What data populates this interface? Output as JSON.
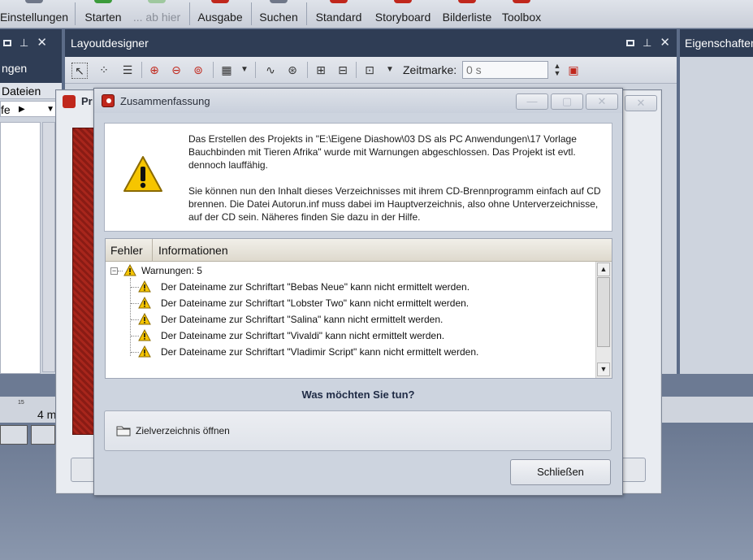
{
  "toolbar": {
    "items": [
      {
        "label": "Einstellungen",
        "enabled": true
      },
      {
        "label": "Starten",
        "enabled": true
      },
      {
        "label": "... ab hier",
        "enabled": false
      },
      {
        "label": "Ausgabe",
        "enabled": true
      },
      {
        "label": "Suchen",
        "enabled": true
      },
      {
        "label": "Standard",
        "enabled": true
      },
      {
        "label": "Storyboard",
        "enabled": true
      },
      {
        "label": "Bilderliste",
        "enabled": true
      },
      {
        "label": "Toolbox",
        "enabled": true
      }
    ]
  },
  "left_panel": {
    "title": "",
    "items": [
      "ngen",
      "Dateien",
      "fe"
    ],
    "ruler_tick": "15",
    "ruler_time": "4 m"
  },
  "layout_panel": {
    "title": "Layoutdesigner",
    "time_label": "Zeitmarke:",
    "time_placeholder": "0 s"
  },
  "props_panel": {
    "title": "Eigenschaften"
  },
  "bg_window": {
    "title": "Pr"
  },
  "dialog": {
    "title": "Zusammenfassung",
    "message_1": "Das Erstellen des Projekts in \"E:\\Eigene Diashow\\03 DS als PC Anwendungen\\17 Vorlage Bauchbinden mit Tieren Afrika\" wurde mit Warnungen abgeschlossen. Das Projekt ist evtl. dennoch lauffähig.",
    "message_2": "Sie können nun den Inhalt dieses Verzeichnisses mit ihrem CD-Brennprogramm einfach auf CD brennen. Die Datei Autorun.inf muss dabei im Hauptverzeichnis, also ohne Unterverzeichnisse, auf der CD sein. Näheres finden Sie dazu in der Hilfe.",
    "columns": [
      "Fehler",
      "Informationen"
    ],
    "group_label": "Warnungen: 5",
    "warnings": [
      "Der Dateiname zur Schriftart \"Bebas Neue\" kann nicht ermittelt werden.",
      "Der Dateiname zur Schriftart \"Lobster Two\" kann nicht ermittelt werden.",
      "Der Dateiname zur Schriftart \"Salina\" kann nicht ermittelt werden.",
      "Der Dateiname zur Schriftart \"Vivaldi\" kann nicht ermittelt werden.",
      "Der Dateiname zur Schriftart \"Vladimir Script\" kann nicht ermittelt werden."
    ],
    "question": "Was möchten Sie tun?",
    "open_folder_label": "Zielverzeichnis öffnen",
    "close_label": "Schließen"
  },
  "colors": {
    "accent_red": "#c0271c",
    "warning_yellow": "#f6c500",
    "panel_header": "#2f3d55"
  }
}
